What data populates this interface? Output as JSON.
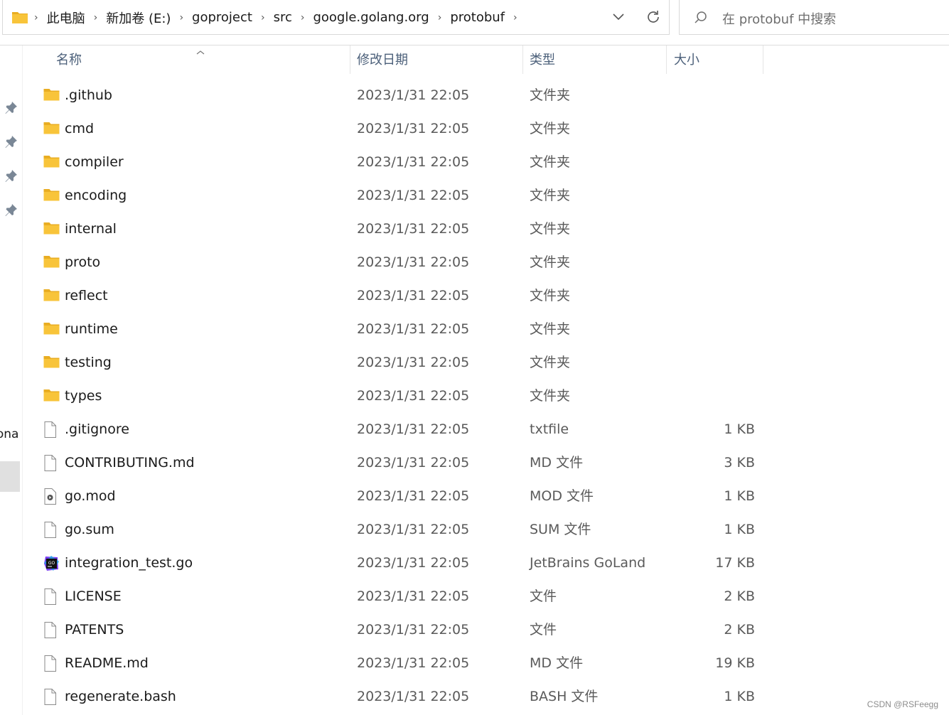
{
  "breadcrumb": [
    "此电脑",
    "新加卷 (E:)",
    "goproject",
    "src",
    "google.golang.org",
    "protobuf"
  ],
  "search_placeholder": "在 protobuf 中搜索",
  "nav_partial_text": "sona",
  "columns": {
    "name": "名称",
    "modified": "修改日期",
    "type": "类型",
    "size": "大小"
  },
  "files": [
    {
      "name": ".github",
      "date": "2023/1/31 22:05",
      "type": "文件夹",
      "size": "",
      "icon": "folder-icon"
    },
    {
      "name": "cmd",
      "date": "2023/1/31 22:05",
      "type": "文件夹",
      "size": "",
      "icon": "folder-icon"
    },
    {
      "name": "compiler",
      "date": "2023/1/31 22:05",
      "type": "文件夹",
      "size": "",
      "icon": "folder-icon"
    },
    {
      "name": "encoding",
      "date": "2023/1/31 22:05",
      "type": "文件夹",
      "size": "",
      "icon": "folder-icon"
    },
    {
      "name": "internal",
      "date": "2023/1/31 22:05",
      "type": "文件夹",
      "size": "",
      "icon": "folder-icon"
    },
    {
      "name": "proto",
      "date": "2023/1/31 22:05",
      "type": "文件夹",
      "size": "",
      "icon": "folder-icon"
    },
    {
      "name": "reflect",
      "date": "2023/1/31 22:05",
      "type": "文件夹",
      "size": "",
      "icon": "folder-icon"
    },
    {
      "name": "runtime",
      "date": "2023/1/31 22:05",
      "type": "文件夹",
      "size": "",
      "icon": "folder-icon"
    },
    {
      "name": "testing",
      "date": "2023/1/31 22:05",
      "type": "文件夹",
      "size": "",
      "icon": "folder-icon"
    },
    {
      "name": "types",
      "date": "2023/1/31 22:05",
      "type": "文件夹",
      "size": "",
      "icon": "folder-icon"
    },
    {
      "name": ".gitignore",
      "date": "2023/1/31 22:05",
      "type": "txtfile",
      "size": "1 KB",
      "icon": "file-icon"
    },
    {
      "name": "CONTRIBUTING.md",
      "date": "2023/1/31 22:05",
      "type": "MD 文件",
      "size": "3 KB",
      "icon": "file-icon"
    },
    {
      "name": "go.mod",
      "date": "2023/1/31 22:05",
      "type": "MOD 文件",
      "size": "1 KB",
      "icon": "mod-file-icon"
    },
    {
      "name": "go.sum",
      "date": "2023/1/31 22:05",
      "type": "SUM 文件",
      "size": "1 KB",
      "icon": "file-icon"
    },
    {
      "name": "integration_test.go",
      "date": "2023/1/31 22:05",
      "type": "JetBrains GoLand",
      "size": "17 KB",
      "icon": "goland-icon"
    },
    {
      "name": "LICENSE",
      "date": "2023/1/31 22:05",
      "type": "文件",
      "size": "2 KB",
      "icon": "file-icon"
    },
    {
      "name": "PATENTS",
      "date": "2023/1/31 22:05",
      "type": "文件",
      "size": "2 KB",
      "icon": "file-icon"
    },
    {
      "name": "README.md",
      "date": "2023/1/31 22:05",
      "type": "MD 文件",
      "size": "19 KB",
      "icon": "file-icon"
    },
    {
      "name": "regenerate.bash",
      "date": "2023/1/31 22:05",
      "type": "BASH 文件",
      "size": "1 KB",
      "icon": "file-icon"
    }
  ],
  "watermark": "CSDN @RSFeegg",
  "colors": {
    "folder": "#f8c43a",
    "header_text": "#4c607a",
    "selection": "#e0e0e0"
  }
}
